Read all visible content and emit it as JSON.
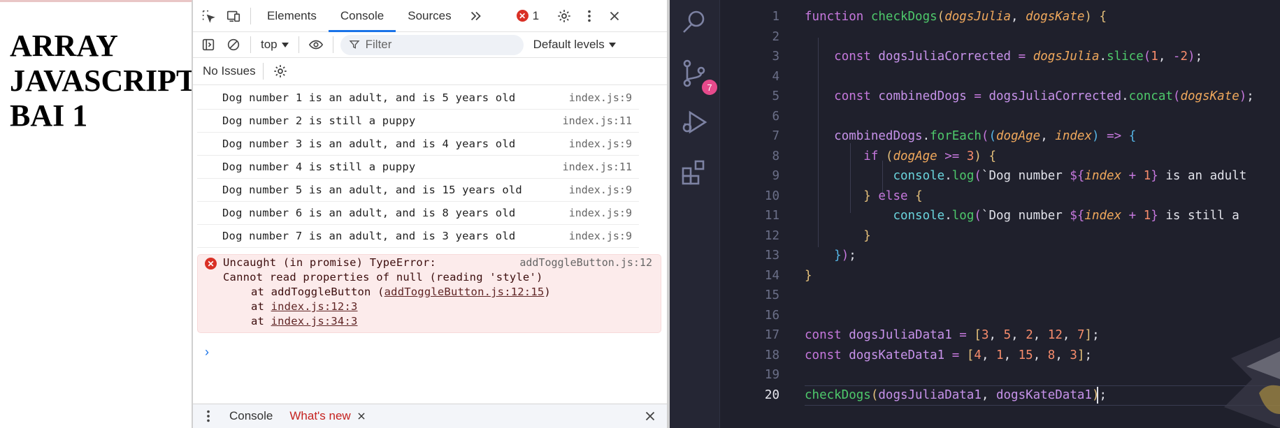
{
  "page": {
    "heading_lines": [
      "ARRAY",
      "JAVASCRIPT",
      "BAI 1"
    ]
  },
  "devtools": {
    "tabs": [
      {
        "label": "Elements",
        "active": false
      },
      {
        "label": "Console",
        "active": true
      },
      {
        "label": "Sources",
        "active": false
      }
    ],
    "error_count": "1",
    "context_select": "top",
    "filter_placeholder": "Filter",
    "levels_select": "Default levels",
    "issues_label": "No Issues",
    "logs": [
      {
        "message": "Dog number 1 is an adult, and is 5 years old",
        "source": "index.js:9"
      },
      {
        "message": "Dog number 2 is still a puppy",
        "source": "index.js:11"
      },
      {
        "message": "Dog number 3 is an adult, and is 4 years old",
        "source": "index.js:9"
      },
      {
        "message": "Dog number 4 is still a puppy",
        "source": "index.js:11"
      },
      {
        "message": "Dog number 5 is an adult, and is 15 years old",
        "source": "index.js:9"
      },
      {
        "message": "Dog number 6 is an adult, and is 8 years old",
        "source": "index.js:9"
      },
      {
        "message": "Dog number 7 is an adult, and is 3 years old",
        "source": "index.js:9"
      }
    ],
    "error": {
      "title": "Uncaught (in promise) TypeError:",
      "source": "addToggleButton.js:12",
      "detail": "Cannot read properties of null (reading 'style')",
      "stack": [
        {
          "prefix": "at addToggleButton (",
          "link": "addToggleButton.js:12:15",
          "suffix": ")"
        },
        {
          "prefix": "at ",
          "link": "index.js:12:3",
          "suffix": ""
        },
        {
          "prefix": "at ",
          "link": "index.js:34:3",
          "suffix": ""
        }
      ]
    },
    "drawer": {
      "console_tab": "Console",
      "whats_new_tab": "What's new"
    }
  },
  "editor": {
    "scm_badge": "7",
    "line_numbers": [
      "1",
      "2",
      "3",
      "4",
      "5",
      "6",
      "7",
      "8",
      "9",
      "10",
      "11",
      "12",
      "13",
      "14",
      "15",
      "16",
      "17",
      "18",
      "19",
      "20"
    ],
    "current_line": "20"
  }
}
